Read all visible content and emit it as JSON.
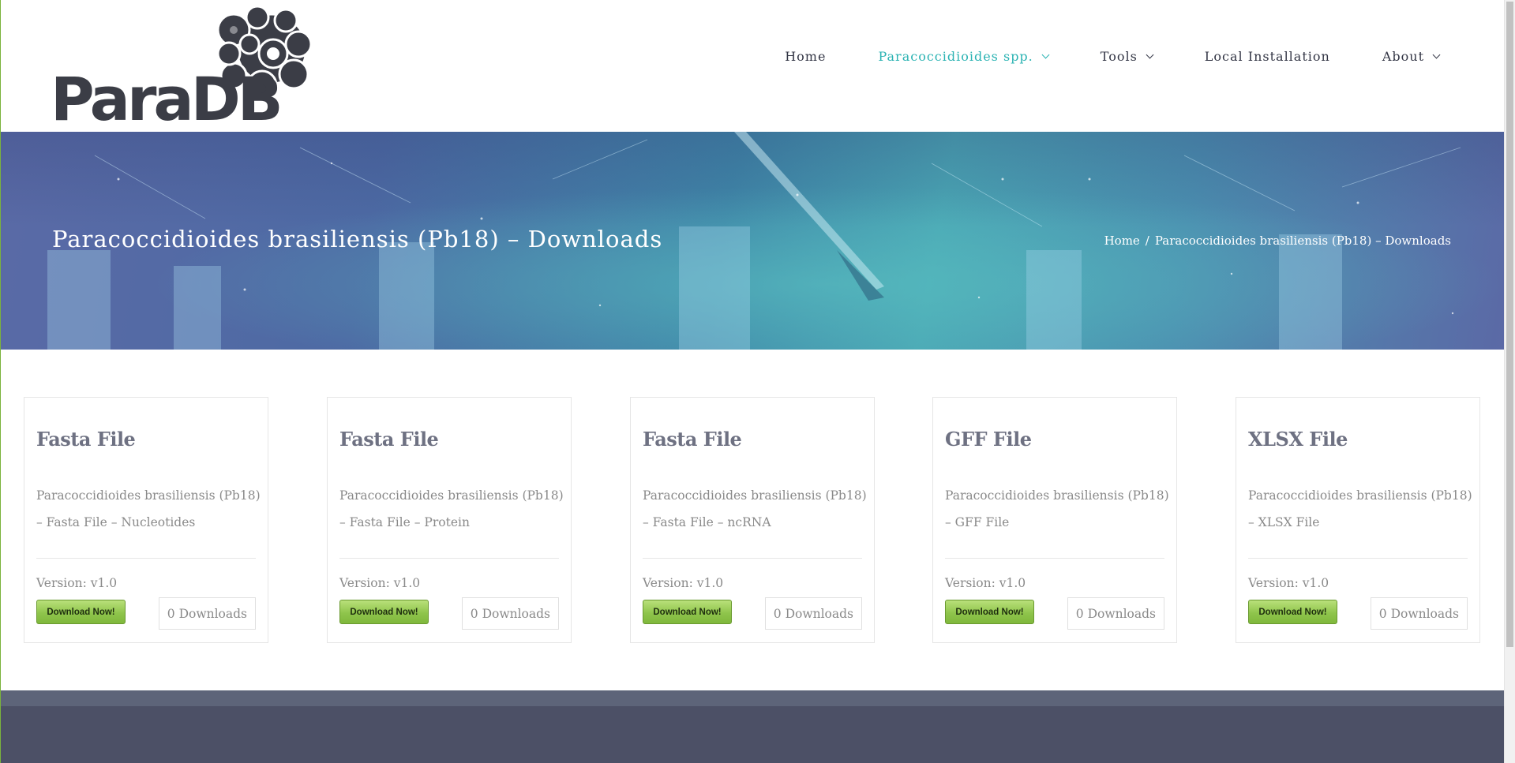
{
  "site": {
    "logo_text": "ParaDB",
    "brand_color": "#2bb3b3"
  },
  "nav": {
    "items": [
      {
        "label": "Home",
        "dropdown": false,
        "active": false
      },
      {
        "label": "Paracoccidioides spp.",
        "dropdown": true,
        "active": true
      },
      {
        "label": "Tools",
        "dropdown": true,
        "active": false
      },
      {
        "label": "Local Installation",
        "dropdown": false,
        "active": false
      },
      {
        "label": "About",
        "dropdown": true,
        "active": false
      }
    ]
  },
  "banner": {
    "title": "Paracoccidioides brasiliensis (Pb18) – Downloads",
    "breadcrumb": {
      "home": "Home",
      "separator": "/",
      "current": "Paracoccidioides brasiliensis (Pb18) – Downloads"
    }
  },
  "downloads": [
    {
      "title": "Fasta File",
      "description": "Paracoccidioides brasiliensis (Pb18) – Fasta File – Nucleotides",
      "version": "Version: v1.0",
      "button": "Download Now!",
      "count": "0 Downloads"
    },
    {
      "title": "Fasta File",
      "description": "Paracoccidioides brasiliensis (Pb18) – Fasta File – Protein",
      "version": "Version: v1.0",
      "button": "Download Now!",
      "count": "0 Downloads"
    },
    {
      "title": "Fasta File",
      "description": "Paracoccidioides brasiliensis (Pb18) – Fasta File – ncRNA",
      "version": "Version: v1.0",
      "button": "Download Now!",
      "count": "0 Downloads"
    },
    {
      "title": "GFF File",
      "description": "Paracoccidioides brasiliensis (Pb18) – GFF File",
      "version": "Version: v1.0",
      "button": "Download Now!",
      "count": "0 Downloads"
    },
    {
      "title": "XLSX File",
      "description": "Paracoccidioides brasiliensis (Pb18) – XLSX File",
      "version": "Version: v1.0",
      "button": "Download Now!",
      "count": "0 Downloads"
    }
  ]
}
